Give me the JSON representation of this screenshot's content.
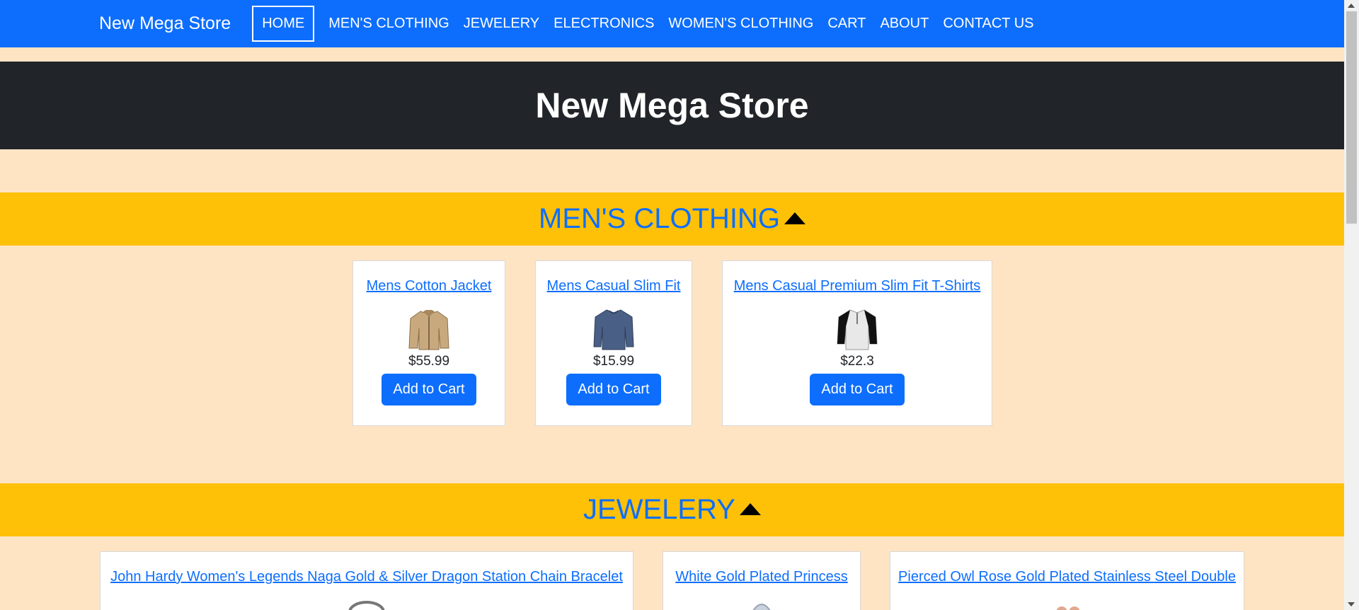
{
  "navbar": {
    "brand": "New Mega Store",
    "items": [
      {
        "label": "HOME",
        "active": true
      },
      {
        "label": "MEN'S CLOTHING"
      },
      {
        "label": "JEWELERY"
      },
      {
        "label": "ELECTRONICS"
      },
      {
        "label": "WOMEN'S CLOTHING"
      },
      {
        "label": "CART"
      },
      {
        "label": "ABOUT"
      },
      {
        "label": "CONTACT US"
      }
    ]
  },
  "hero": {
    "title": "New Mega Store"
  },
  "sections": [
    {
      "title": "MEN'S CLOTHING",
      "products": [
        {
          "title": "Mens Cotton Jacket",
          "price": "$55.99",
          "button": "Add to Cart",
          "image": "jacket-icon"
        },
        {
          "title": "Mens Casual Slim Fit",
          "price": "$15.99",
          "button": "Add to Cart",
          "image": "shirt-icon"
        },
        {
          "title": "Mens Casual Premium Slim Fit T-Shirts",
          "price": "$22.3",
          "button": "Add to Cart",
          "image": "tshirt-icon"
        }
      ]
    },
    {
      "title": "JEWELERY",
      "products": [
        {
          "title": "John Hardy Women's Legends Naga Gold & Silver Dragon Station Chain Bracelet",
          "image": "bracelet-icon"
        },
        {
          "title": "White Gold Plated Princess",
          "image": "ring-icon"
        },
        {
          "title": "Pierced Owl Rose Gold Plated Stainless Steel Double",
          "image": "earrings-icon"
        }
      ]
    }
  ],
  "colors": {
    "navbar": "#0d6efd",
    "hero": "#212529",
    "section_bar": "#ffc107",
    "background": "#ffe4c4",
    "link": "#0d6efd"
  }
}
